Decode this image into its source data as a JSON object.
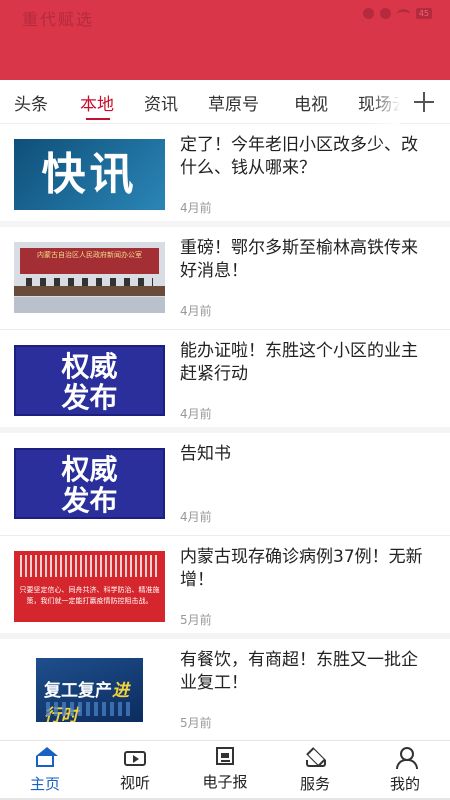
{
  "status_bar": {
    "left_text": "重代赋选",
    "battery": "45"
  },
  "tabs": [
    {
      "label": "头条"
    },
    {
      "label": "本地",
      "active": true
    },
    {
      "label": "资讯"
    },
    {
      "label": "草原号"
    },
    {
      "label": "电视"
    },
    {
      "label": "现场云"
    }
  ],
  "news": [
    {
      "title": "定了！今年老旧小区改多少、改什么、钱从哪来？",
      "time": "4月前",
      "thumb_text": "快讯"
    },
    {
      "title": "重磅！鄂尔多斯至榆林高铁传来好消息！",
      "time": "4月前",
      "thumb_text": "内蒙古自治区人民政府新闻办公室"
    },
    {
      "title": "能办证啦！东胜这个小区的业主赶紧行动",
      "time": "4月前",
      "thumb_line1": "权威",
      "thumb_line2": "发布"
    },
    {
      "title": "告知书",
      "time": "4月前",
      "thumb_line1": "权威",
      "thumb_line2": "发布"
    },
    {
      "title": "内蒙古现存确诊病例37例！无新增！",
      "time": "5月前",
      "thumb_text": "只要坚定信心、同舟共济、科学防治、精准施策，我们就一定能打赢疫情防控阻击战。"
    },
    {
      "title": "有餐饮，有商超！东胜又一批企业复工！",
      "time": "5月前",
      "thumb_line1": "复工复产",
      "thumb_line2": "进行时"
    }
  ],
  "bottom_nav": [
    {
      "label": "主页",
      "active": true
    },
    {
      "label": "视听"
    },
    {
      "label": "电子报"
    },
    {
      "label": "服务"
    },
    {
      "label": "我的"
    }
  ],
  "colors": {
    "brand_red": "#d9364a",
    "active_tab": "#c8102e",
    "active_nav": "#1a61c4"
  }
}
